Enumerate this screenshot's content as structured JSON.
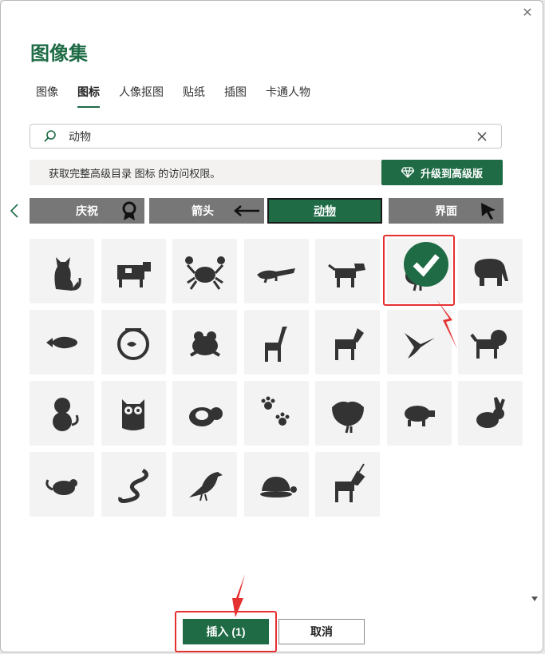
{
  "dialog": {
    "title": "图像集"
  },
  "tabs": [
    {
      "label": "图像",
      "active": false
    },
    {
      "label": "图标",
      "active": true
    },
    {
      "label": "人像抠图",
      "active": false
    },
    {
      "label": "贴纸",
      "active": false
    },
    {
      "label": "插图",
      "active": false
    },
    {
      "label": "卡通人物",
      "active": false
    }
  ],
  "search": {
    "value": "动物"
  },
  "banner": {
    "text": "获取完整高级目录 图标 的访问权限。",
    "upgrade_label": "升级到高级版"
  },
  "categories": [
    {
      "label": "庆祝",
      "icon": "ribbon-award-icon"
    },
    {
      "label": "箭头",
      "icon": "arrow-left-icon"
    },
    {
      "label": "动物",
      "active": true
    },
    {
      "label": "界面",
      "icon": "cursor-icon"
    }
  ],
  "icons": [
    "cat-icon",
    "cow-icon",
    "crab-icon",
    "crocodile-icon",
    "dog-icon",
    "duck-icon",
    "elephant-icon",
    "fish-icon",
    "fishbowl-icon",
    "frog-icon",
    "giraffe-icon",
    "horse-icon",
    "hummingbird-icon",
    "lion-icon",
    "monkey-icon",
    "owl-icon",
    "panda-icon",
    "paw-prints-icon",
    "peacock-icon",
    "pig-icon",
    "rabbit-icon",
    "mouse-icon",
    "snake-icon",
    "bird-icon",
    "turtle-icon",
    "unicorn-icon"
  ],
  "selected_icon": "duck-icon",
  "colors": {
    "accent": "#1e6b45",
    "icon": "#333333",
    "annotation": "#e53030"
  },
  "footer": {
    "insert_label": "插入 (1)",
    "cancel_label": "取消"
  }
}
